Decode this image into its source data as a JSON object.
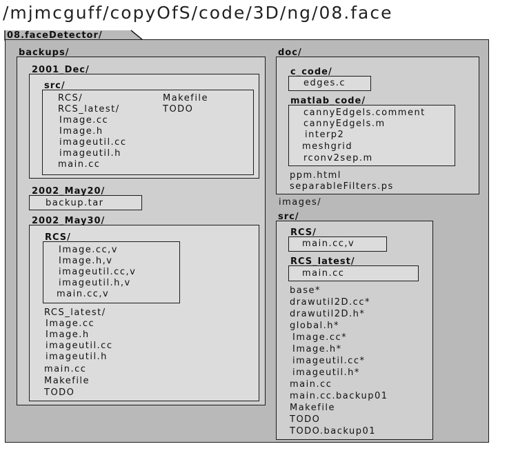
{
  "path_title": "/mjmcguff/copyOfS/code/3D/ng/08.face",
  "root": {
    "label": "08.faceDetector/"
  },
  "backups": {
    "label": "backups/",
    "dec2001": {
      "label": "2001_Dec/",
      "src": {
        "label": "src/",
        "files_left": [
          "RCS/",
          "RCS_latest/",
          "Image.cc",
          "Image.h",
          "imageutil.cc",
          "imageutil.h",
          "main.cc"
        ],
        "files_right": [
          "Makefile",
          "TODO"
        ]
      }
    },
    "may2002_20": {
      "label": "2002_May20/",
      "files": [
        "backup.tar"
      ]
    },
    "may2002_30": {
      "label": "2002_May30/",
      "rcs": {
        "label": "RCS/",
        "files": [
          "Image.cc,v",
          "Image.h,v",
          "imageutil.cc,v",
          "imageutil.h,v",
          "main.cc,v"
        ]
      },
      "files": [
        "RCS_latest/",
        "Image.cc",
        "Image.h",
        "imageutil.cc",
        "imageutil.h",
        "main.cc",
        "Makefile",
        "TODO"
      ]
    }
  },
  "doc": {
    "label": "doc/",
    "c_code": {
      "label": "c_code/",
      "files": [
        "edges.c"
      ]
    },
    "matlab_code": {
      "label": "matlab_code/",
      "files": [
        "cannyEdgels.comment",
        "cannyEdgels.m",
        "interp2",
        "meshgrid",
        "rconv2sep.m"
      ]
    },
    "files": [
      "ppm.html",
      "separableFilters.ps"
    ]
  },
  "images": {
    "label": "images/"
  },
  "src": {
    "label": "src/",
    "rcs": {
      "label": "RCS/",
      "files": [
        "main.cc,v"
      ]
    },
    "rcs_latest": {
      "label": "RCS_latest/",
      "files": [
        "main.cc"
      ]
    },
    "files": [
      "base*",
      "drawutil2D.cc*",
      "drawutil2D.h*",
      "global.h*",
      "Image.cc*",
      "Image.h*",
      "imageutil.cc*",
      "imageutil.h*",
      "main.cc",
      "main.cc.backup01",
      "Makefile",
      "TODO",
      "TODO.backup01"
    ]
  }
}
